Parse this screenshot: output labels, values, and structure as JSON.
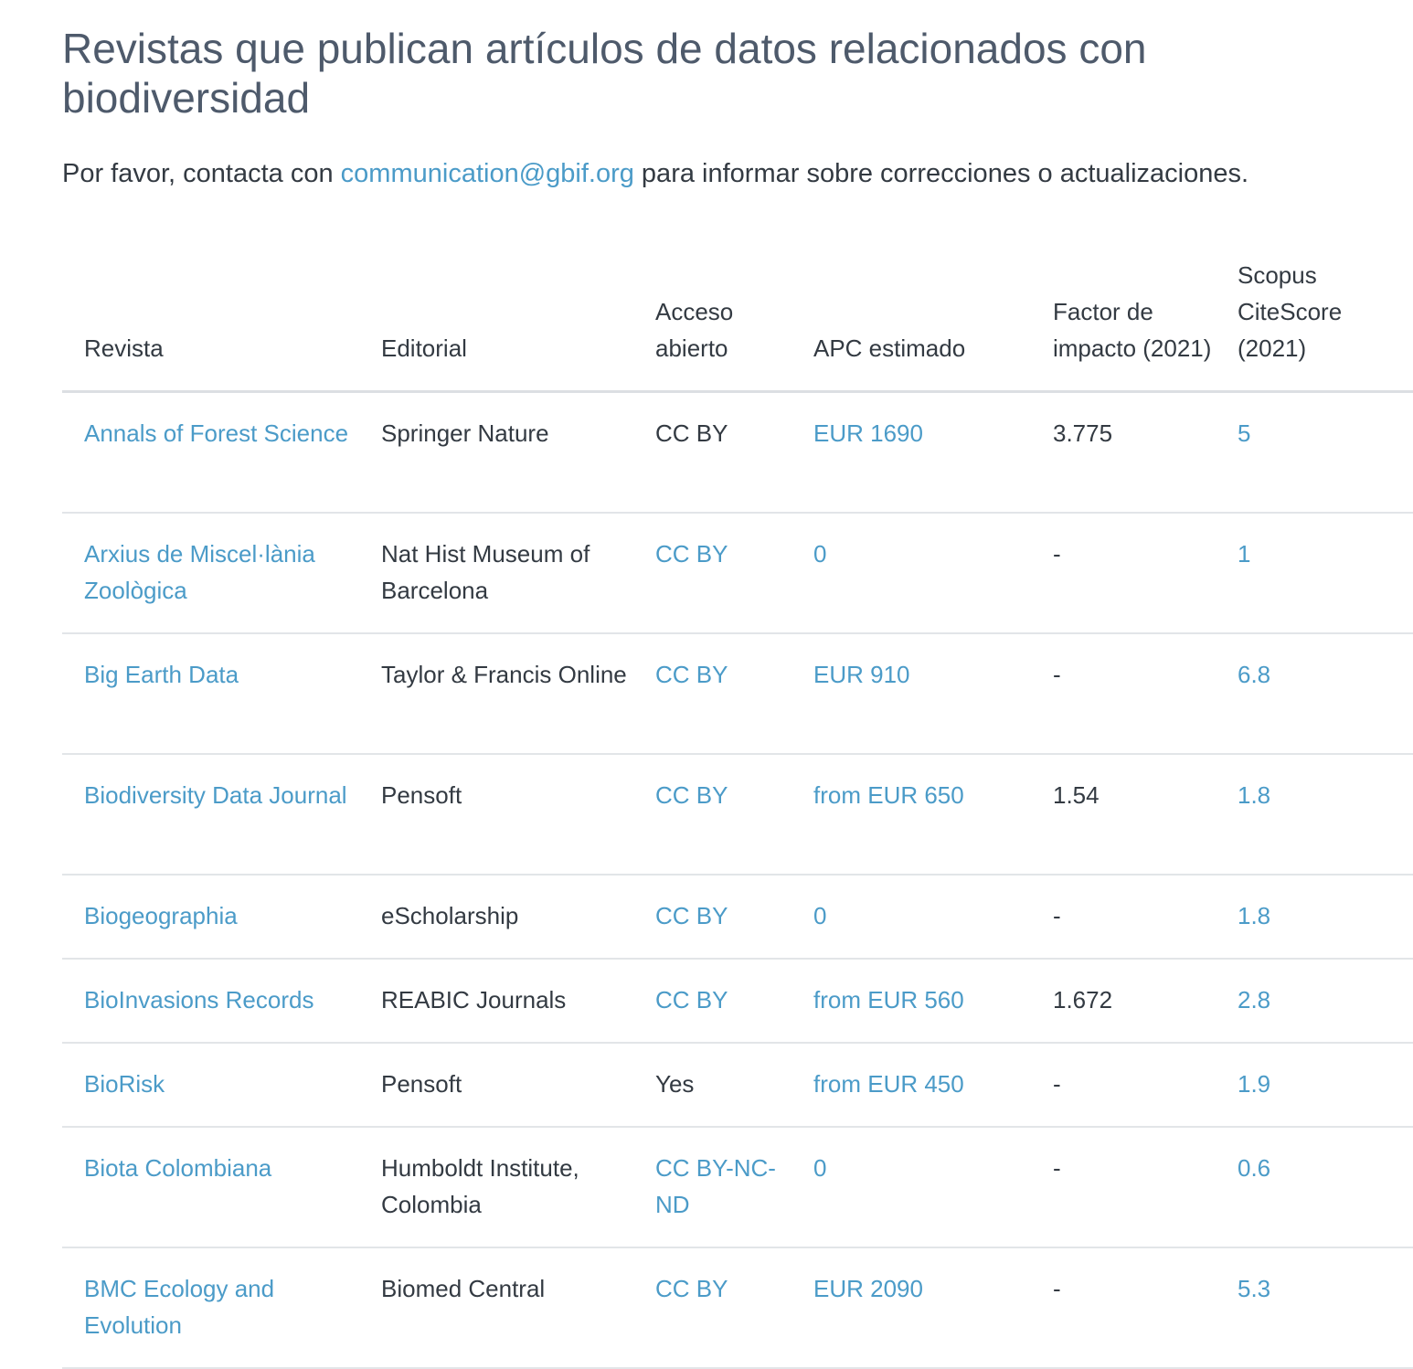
{
  "header": {
    "title": "Revistas que publican artículos de datos relacionados con biodiversidad",
    "intro_before": "Por favor, contacta con ",
    "intro_email": "communication@gbif.org",
    "intro_after": " para informar sobre correcciones o actualizaciones."
  },
  "table": {
    "headers": {
      "journal": "Revista",
      "publisher": "Editorial",
      "open_access": "Acceso abierto",
      "apc": "APC estimado",
      "impact": "Factor de impacto (2021)",
      "citescore": "Scopus CiteScore (2021)"
    },
    "rows": [
      {
        "journal": "Annals of Forest Science",
        "publisher": "Springer Nature",
        "open_access": "CC BY",
        "oa_link": false,
        "apc": "EUR 1690",
        "impact": "3.775",
        "citescore": "5"
      },
      {
        "journal": "Arxius de Miscel·lània Zoològica",
        "publisher": "Nat Hist Museum of Barcelona",
        "open_access": "CC BY",
        "oa_link": true,
        "apc": "0",
        "impact": "-",
        "citescore": "1"
      },
      {
        "journal": "Big Earth Data",
        "publisher": "Taylor & Francis Online",
        "open_access": "CC BY",
        "oa_link": true,
        "apc": "EUR 910",
        "impact": "-",
        "citescore": "6.8"
      },
      {
        "journal": "Biodiversity Data Journal",
        "publisher": "Pensoft",
        "open_access": "CC BY",
        "oa_link": true,
        "apc": "from EUR 650",
        "impact": "1.54",
        "citescore": "1.8"
      },
      {
        "journal": "Biogeographia",
        "publisher": "eScholarship",
        "open_access": "CC BY",
        "oa_link": true,
        "apc": "0",
        "impact": "-",
        "citescore": "1.8"
      },
      {
        "journal": "BioInvasions Records",
        "publisher": "REABIC Journals",
        "open_access": "CC BY",
        "oa_link": true,
        "apc": "from EUR 560",
        "impact": "1.672",
        "citescore": "2.8"
      },
      {
        "journal": "BioRisk",
        "publisher": "Pensoft",
        "open_access": "Yes",
        "oa_link": false,
        "apc": "from EUR 450",
        "impact": "-",
        "citescore": "1.9"
      },
      {
        "journal": "Biota Colombiana",
        "publisher": "Humboldt Institute, Colombia",
        "open_access": "CC BY-NC-ND",
        "oa_link": true,
        "apc": "0",
        "impact": "-",
        "citescore": "0.6"
      },
      {
        "journal": "BMC Ecology and Evolution",
        "publisher": "Biomed Central",
        "open_access": "CC BY",
        "oa_link": true,
        "apc": "EUR 2090",
        "impact": "-",
        "citescore": "5.3"
      }
    ]
  }
}
